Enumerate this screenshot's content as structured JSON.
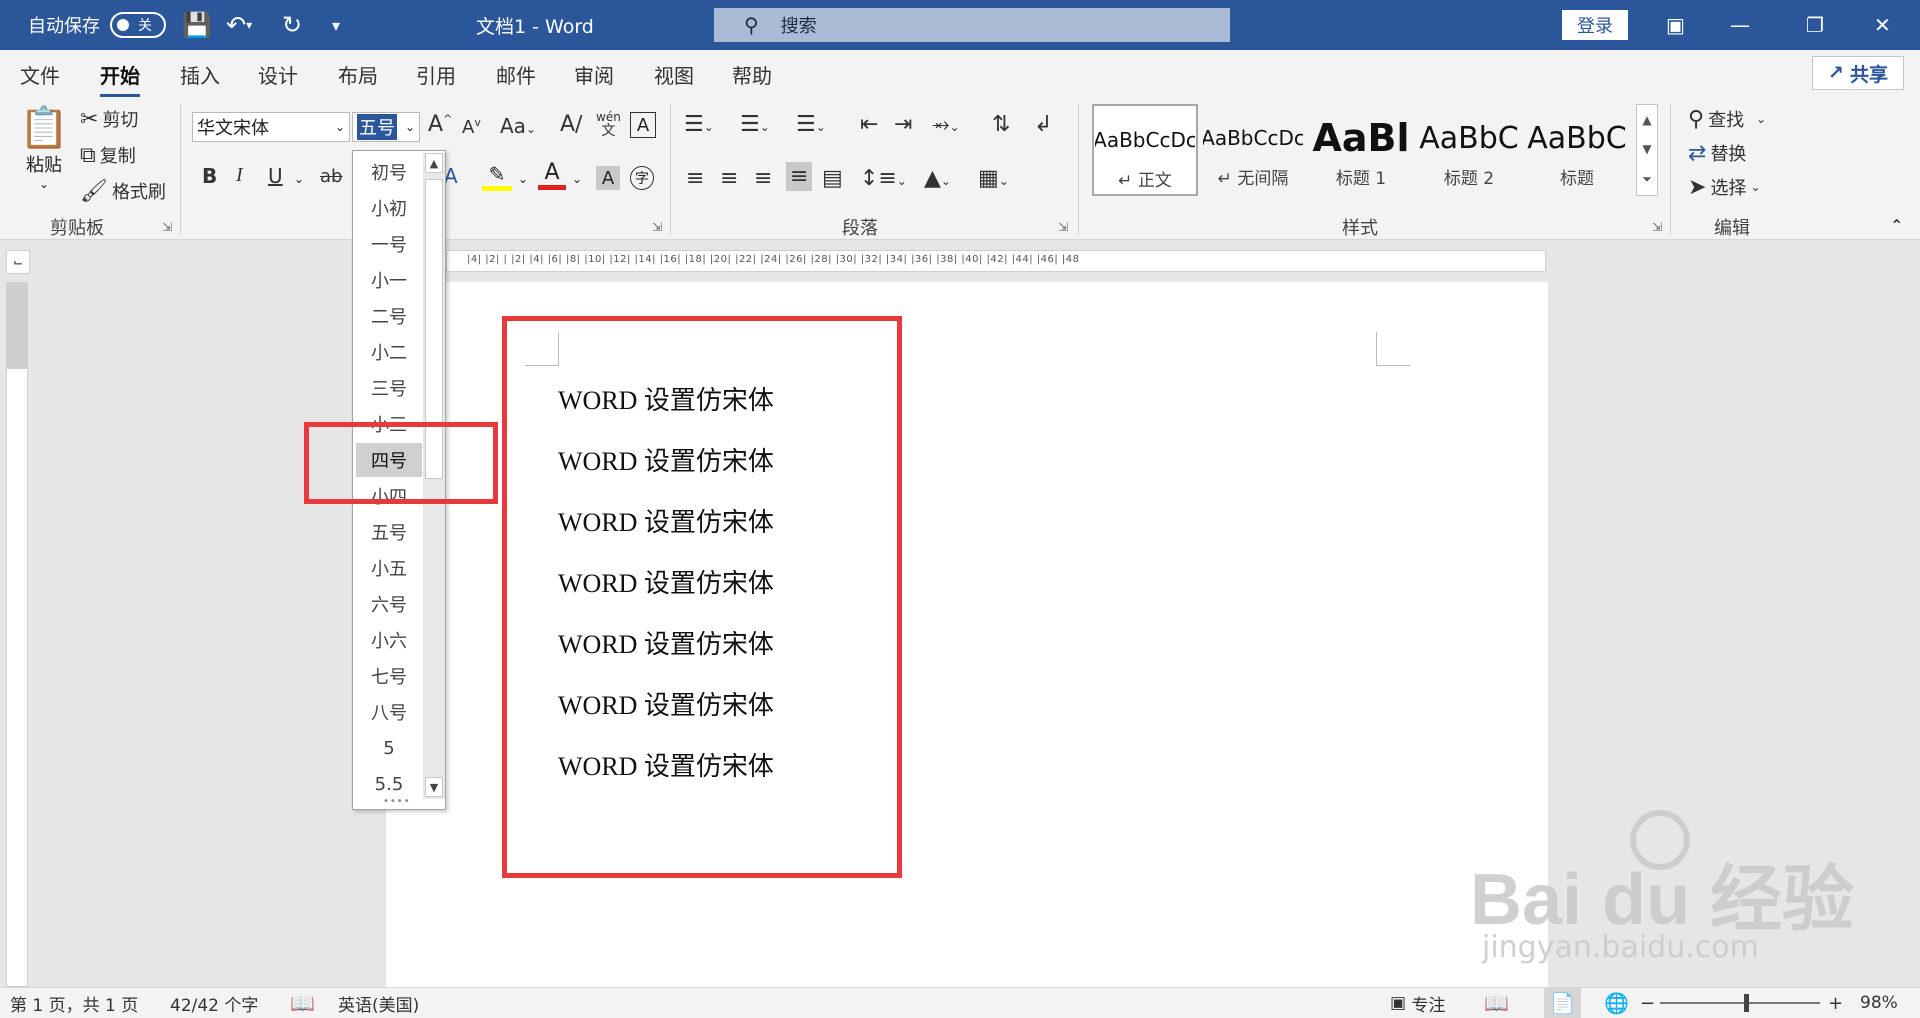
{
  "titlebar": {
    "autosave_label": "自动保存",
    "autosave_state": "关",
    "doc_title": "文档1  -  Word",
    "search_placeholder": "搜索",
    "login": "登录"
  },
  "tabs": [
    "文件",
    "开始",
    "插入",
    "设计",
    "布局",
    "引用",
    "邮件",
    "审阅",
    "视图",
    "帮助"
  ],
  "active_tab": "开始",
  "share": "共享",
  "clipboard": {
    "paste": "粘贴",
    "cut": "剪切",
    "copy": "复制",
    "format_painter": "格式刷",
    "group": "剪贴板"
  },
  "font": {
    "name": "华文宋体",
    "size": "五号",
    "bold": "B",
    "italic": "I",
    "underline": "U",
    "strike": "ab",
    "grow": "A",
    "shrink": "A",
    "change_case": "Aa",
    "phonetic": "wén",
    "border_char": "A",
    "shade_char": "A"
  },
  "paragraph": {
    "group": "段落"
  },
  "styles": {
    "group": "样式",
    "items": [
      {
        "preview": "AaBbCcDc",
        "label": "↵ 正文"
      },
      {
        "preview": "AaBbCcDc",
        "label": "↵ 无间隔"
      },
      {
        "preview": "AaBl",
        "label": "标题 1"
      },
      {
        "preview": "AaBbC",
        "label": "标题 2"
      },
      {
        "preview": "AaBbC",
        "label": "标题"
      }
    ]
  },
  "editing": {
    "find": "查找",
    "replace": "替换",
    "select": "选择",
    "group": "编辑"
  },
  "size_dropdown": {
    "items": [
      "初号",
      "小初",
      "一号",
      "小一",
      "二号",
      "小二",
      "三号",
      "小三",
      "四号",
      "小四",
      "五号",
      "小五",
      "六号",
      "小六",
      "七号",
      "八号",
      "5",
      "5.5"
    ],
    "selected": "四号"
  },
  "ruler_ticks": "|4|  |2|  |  |2|  |4|  |6|  |8|  |10|  |12|  |14|  |16|  |18|  |20|  |22|  |24|  |26|  |28|  |30|  |32|  |34|  |36|  |38|  |40|  |42|  |44|  |46|  |48",
  "document": {
    "lines": [
      "WORD 设置仿宋体",
      "WORD 设置仿宋体",
      "WORD 设置仿宋体",
      "WORD 设置仿宋体",
      "WORD 设置仿宋体",
      "WORD 设置仿宋体",
      "WORD 设置仿宋体"
    ]
  },
  "status": {
    "page": "第 1 页，共 1 页",
    "words": "42/42 个字",
    "language": "英语(美国)",
    "focus": "专注",
    "zoom": "98%",
    "zoom_minus": "−",
    "zoom_plus": "+"
  },
  "watermark": {
    "brand": "Bai  du 经验",
    "url": "jingyan.baidu.com"
  },
  "colors": {
    "title_bar": "#2b579a",
    "highlight": "#e83a3a",
    "font_color_bar": "#e02020",
    "highlight_color_bar": "#ffff00"
  }
}
